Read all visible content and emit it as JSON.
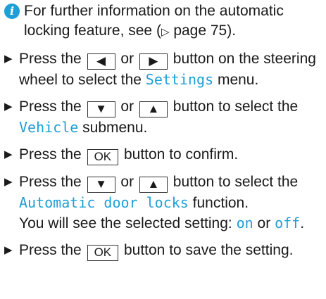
{
  "colors": {
    "accent": "#1e9fd6",
    "text": "#1a1a1a"
  },
  "note": {
    "icon": "info-icon",
    "icon_glyph": "i",
    "text_before": "For further information on the automatic locking feature, see (",
    "ref_glyph": "▷",
    "text_after": " page 75)."
  },
  "steps": [
    {
      "bullet": "▶",
      "parts": {
        "t1": "Press the",
        "key1": "◀",
        "t2": "or",
        "key2": "▶",
        "t3": "button on the steering wheel to select the",
        "disp1": "Settings",
        "t4": "menu."
      }
    },
    {
      "bullet": "▶",
      "parts": {
        "t1": "Press the",
        "key1": "▼",
        "t2": "or",
        "key2": "▲",
        "t3": "button to select the",
        "disp1": "Vehicle",
        "t4": "submenu."
      }
    },
    {
      "bullet": "▶",
      "parts": {
        "t1": "Press the",
        "key1": "OK",
        "t2": "button to confirm."
      }
    },
    {
      "bullet": "▶",
      "parts": {
        "t1": "Press the",
        "key1": "▼",
        "t2": "or",
        "key2": "▲",
        "t3": "button to select the",
        "disp1": "Automatic door locks",
        "t4": "function.",
        "t5": "You will see the selected setting:",
        "disp2": "on",
        "t6": "or",
        "disp3": "off",
        "t7": "."
      }
    },
    {
      "bullet": "▶",
      "parts": {
        "t1": "Press the",
        "key1": "OK",
        "t2": "button to save the setting."
      }
    }
  ]
}
